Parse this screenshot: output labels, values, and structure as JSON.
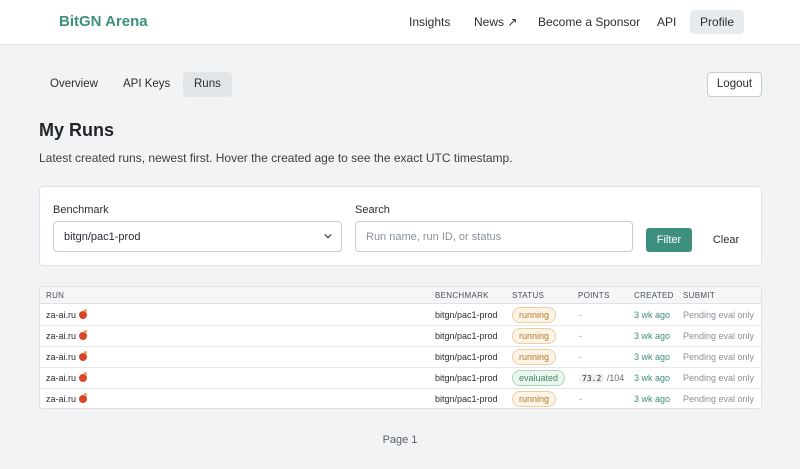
{
  "header": {
    "brand": "BitGN Arena",
    "nav": [
      {
        "label": "Insights"
      },
      {
        "label": "News ↗"
      },
      {
        "label": "Become a Sponsor"
      },
      {
        "label": "API"
      },
      {
        "label": "Profile"
      }
    ]
  },
  "subnav": {
    "tabs": [
      {
        "label": "Overview"
      },
      {
        "label": "API Keys"
      },
      {
        "label": "Runs"
      }
    ],
    "logout_label": "Logout"
  },
  "page": {
    "title": "My Runs",
    "subtitle": "Latest created runs, newest first. Hover the created age to see the exact UTC timestamp."
  },
  "filters": {
    "benchmark_label": "Benchmark",
    "benchmark_value": "bitgn/pac1-prod",
    "search_label": "Search",
    "search_placeholder": "Run name, run ID, or status",
    "filter_button": "Filter",
    "clear_button": "Clear"
  },
  "table": {
    "columns": [
      "RUN",
      "BENCHMARK",
      "STATUS",
      "POINTS",
      "CREATED",
      "SUBMIT"
    ],
    "rows": [
      {
        "run": "za-ai.ru",
        "benchmark": "bitgn/pac1-prod",
        "status": "running",
        "points": "-",
        "points_max": "",
        "created": "3 wk ago",
        "submit": "Pending eval only"
      },
      {
        "run": "za-ai.ru",
        "benchmark": "bitgn/pac1-prod",
        "status": "running",
        "points": "-",
        "points_max": "",
        "created": "3 wk ago",
        "submit": "Pending eval only"
      },
      {
        "run": "za-ai.ru",
        "benchmark": "bitgn/pac1-prod",
        "status": "running",
        "points": "-",
        "points_max": "",
        "created": "3 wk ago",
        "submit": "Pending eval only"
      },
      {
        "run": "za-ai.ru",
        "benchmark": "bitgn/pac1-prod",
        "status": "evaluated",
        "points": "73.2",
        "points_max": "/104",
        "created": "3 wk ago",
        "submit": "Pending eval only"
      },
      {
        "run": "za-ai.ru",
        "benchmark": "bitgn/pac1-prod",
        "status": "running",
        "points": "-",
        "points_max": "",
        "created": "3 wk ago",
        "submit": "Pending eval only"
      }
    ]
  },
  "pagination": {
    "label": "Page 1"
  },
  "colors": {
    "accent": "#3d8f7e",
    "running": "#b07a2a",
    "evaluated": "#3d8a5e"
  }
}
